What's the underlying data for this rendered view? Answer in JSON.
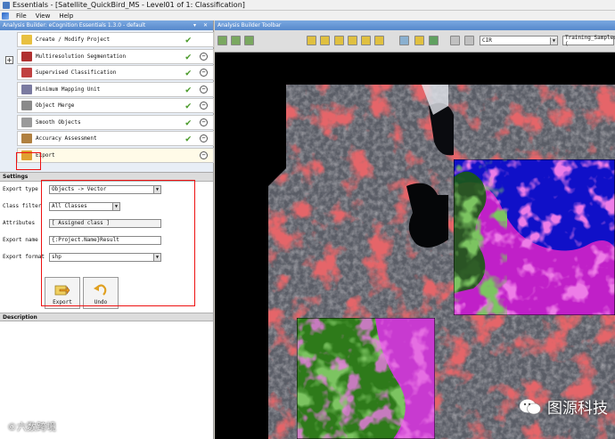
{
  "window": {
    "title": "Essentials - [Satellite_QuickBird_MS - Level01 of 1: Classification]"
  },
  "menu": [
    "File",
    "View",
    "Help"
  ],
  "left_panel": {
    "title": "Analysis Builder: eCognition Essentials 1.3.0 - default",
    "controls": "▾ ✕",
    "add_symbol": "+",
    "steps": [
      {
        "label": "Create / Modify Project",
        "checked": true,
        "removable": false,
        "icon": "folder-icon",
        "color": "#e8c040"
      },
      {
        "label": "Multiresolution Segmentation",
        "checked": true,
        "removable": true,
        "icon": "segmentation-icon",
        "color": "#b03030"
      },
      {
        "label": "Supervised Classification",
        "checked": true,
        "removable": true,
        "icon": "classification-icon",
        "color": "#c04040"
      },
      {
        "label": "Minimum Mapping Unit",
        "checked": true,
        "removable": true,
        "icon": "mapping-unit-icon",
        "color": "#7a7aa0"
      },
      {
        "label": "Object Merge",
        "checked": true,
        "removable": true,
        "icon": "merge-icon",
        "color": "#8a8a8a"
      },
      {
        "label": "Smooth Objects",
        "checked": true,
        "removable": true,
        "icon": "smooth-icon",
        "color": "#9a9a9a"
      },
      {
        "label": "Accuracy Assessment",
        "checked": true,
        "removable": true,
        "icon": "accuracy-icon",
        "color": "#b08040"
      },
      {
        "label": "Export",
        "checked": false,
        "removable": true,
        "icon": "export-icon",
        "color": "#e0a030"
      }
    ],
    "check_symbol": "✔",
    "remove_symbol": "−"
  },
  "settings": {
    "header": "Settings",
    "export_type": {
      "label": "Export type",
      "value": "Objects -> Vector"
    },
    "class_filter": {
      "label": "Class filter",
      "value": "All Classes"
    },
    "attributes": {
      "label": "Attributes",
      "value": "[ Assigned class ]"
    },
    "export_name": {
      "label": "Export name",
      "value": "{:Project.Name}Result"
    },
    "export_format": {
      "label": "Export format",
      "value": "shp"
    },
    "dropdown_symbol": "▼",
    "export_button": "Export",
    "undo_button": "Undo"
  },
  "description": {
    "header": "Description"
  },
  "toolbar": {
    "title": "Analysis Builder Toolbar",
    "band_select": "CIR",
    "samples_select": "Training_Samples (",
    "icon_colors": [
      "#7aa860",
      "#7aa860",
      "#7aa860",
      "#e0c040",
      "#e0c040",
      "#e0c040",
      "#e0c040",
      "#e0c040",
      "#e0c040",
      "#8ab0d0",
      "#e0c040",
      "#60a060",
      "#c0c0c0",
      "#c0c0c0"
    ]
  },
  "watermarks": {
    "brand": "图源科技",
    "corner": "©六数跨境"
  }
}
